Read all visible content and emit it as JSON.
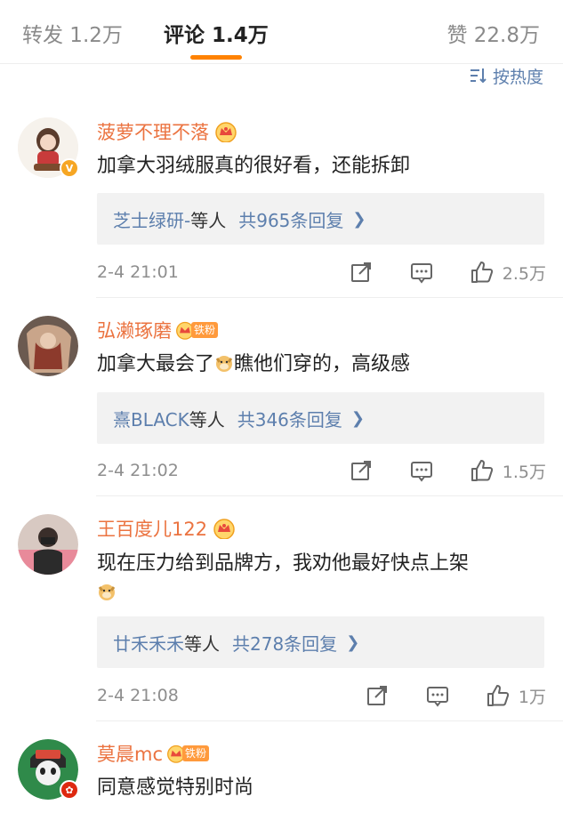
{
  "tabs": {
    "repost": "转发 1.2万",
    "comment": "评论 1.4万",
    "like": "赞 22.8万"
  },
  "sort": {
    "label": "按热度",
    "icon": "sort-icon"
  },
  "colors": {
    "accent": "#ff8200",
    "username": "#eb7340",
    "link": "#5d7fad"
  },
  "comments": [
    {
      "username": "菠萝不理不落",
      "badge": "crown",
      "verified": "V",
      "text": "加拿大羽绒服真的很好看，还能拆卸",
      "reply_names": "芝士绿研-",
      "reply_etc": "等人",
      "reply_count": "共965条回复",
      "time": "2-4 21:01",
      "likes": "2.5万"
    },
    {
      "username": "弘濑琢磨",
      "badge": "fan",
      "fan_tag": "铁粉",
      "text_before": "加拿大最会了",
      "text_after": "瞧他们穿的，高级感",
      "reply_names": "熹BLACK",
      "reply_etc": "等人",
      "reply_count": "共346条回复",
      "time": "2-4 21:02",
      "likes": "1.5万"
    },
    {
      "username": "王百度儿122",
      "badge": "crown",
      "text": "现在压力给到品牌方，我劝他最好快点上架",
      "reply_names": "廿禾禾禾",
      "reply_etc": "等人",
      "reply_count": "共278条回复",
      "time": "2-4 21:08",
      "likes": "1万"
    },
    {
      "username": "莫晨mc",
      "badge": "fan",
      "fan_tag": "铁粉",
      "text": "同意感觉特别时尚"
    }
  ]
}
